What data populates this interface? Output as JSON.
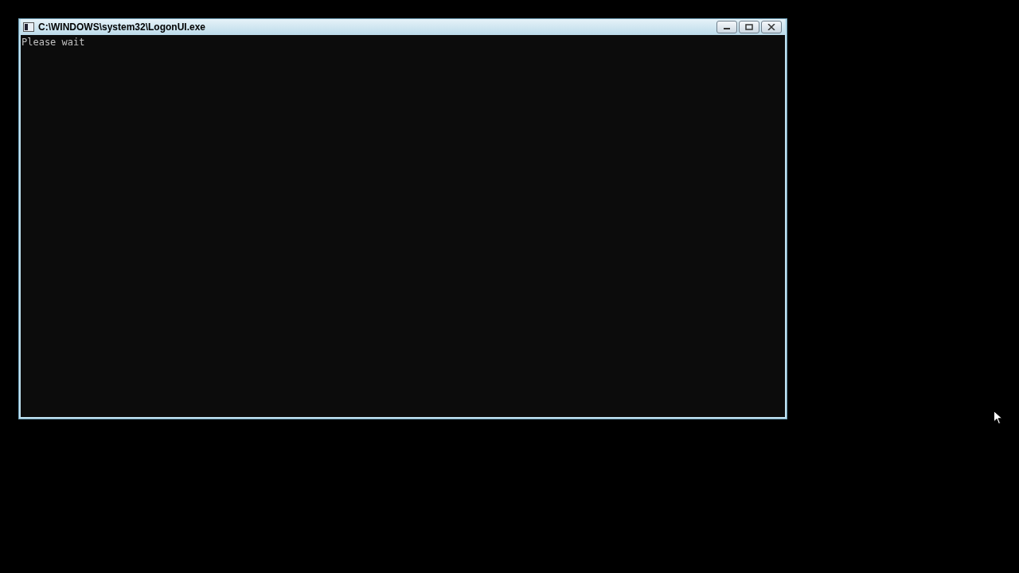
{
  "window": {
    "title": "C:\\WINDOWS\\system32\\LogonUI.exe"
  },
  "console": {
    "lines": [
      "Please wait"
    ]
  }
}
